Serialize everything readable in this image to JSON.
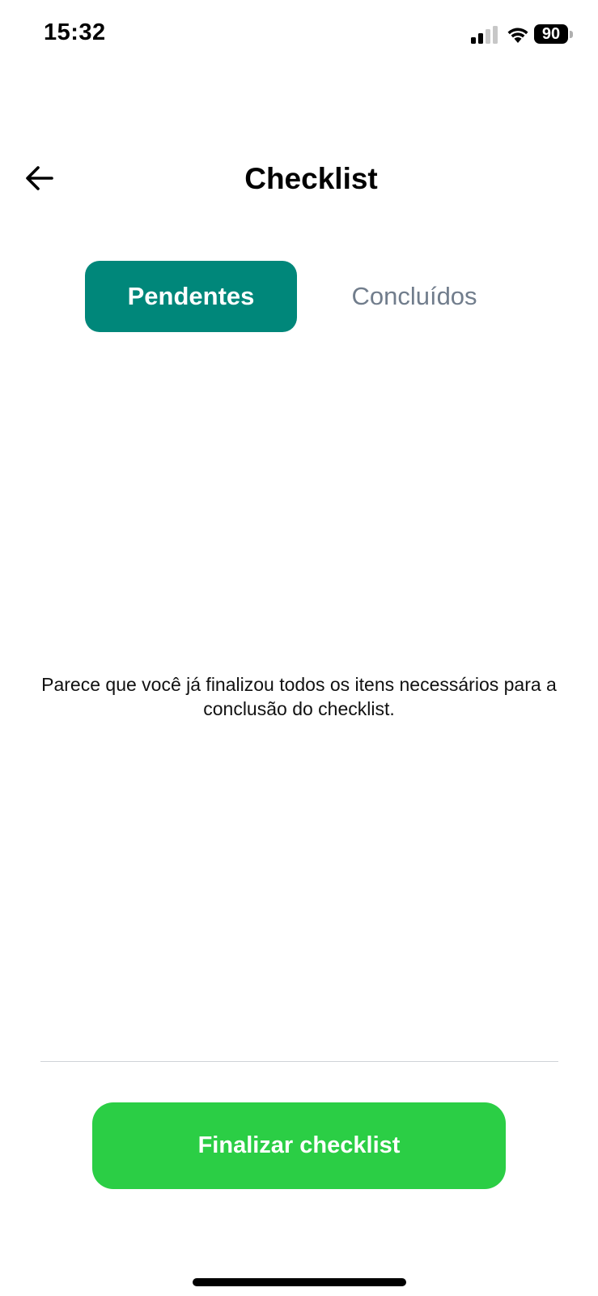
{
  "status_bar": {
    "time": "15:32",
    "battery": "90",
    "icons": [
      "signal-icon",
      "wifi-icon",
      "battery-icon"
    ]
  },
  "header": {
    "title": "Checklist",
    "back_icon": "arrow-left-icon"
  },
  "tabs": [
    {
      "label": "Pendentes",
      "active": true
    },
    {
      "label": "Concluídos",
      "active": false
    }
  ],
  "main": {
    "empty_message": "Parece que você já finalizou todos os itens necessários para a conclusão do checklist."
  },
  "footer": {
    "finish_label": "Finalizar checklist"
  },
  "colors": {
    "tab_active_bg": "#00877a",
    "tab_inactive_text": "#717d8c",
    "finish_button_bg": "#2bce45"
  }
}
